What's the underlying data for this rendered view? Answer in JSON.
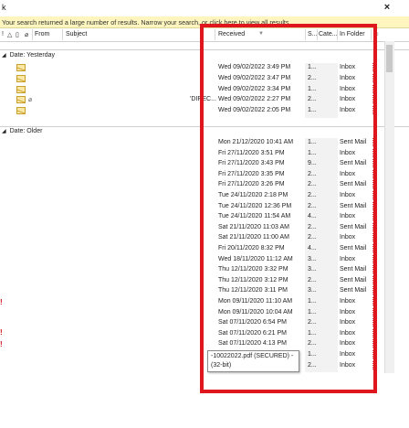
{
  "search": {
    "query": "k",
    "close_glyph": "×"
  },
  "infobar": {
    "message": "Your search returned a large number of results. Narrow your search, or click here to view all results."
  },
  "columns": {
    "from": "From",
    "subject": "Subject",
    "received": "Received",
    "size": "S...",
    "categories": "Cate...",
    "in_folder": "In Folder"
  },
  "groups": {
    "yesterday": "Date: Yesterday",
    "older": "Date: Older"
  },
  "yesterday_rows": [
    {
      "received": "Wed 09/02/2022 3:49 PM",
      "size": "1...",
      "folder": "Inbox"
    },
    {
      "received": "Wed 09/02/2022 3:47 PM",
      "size": "2...",
      "folder": "Inbox"
    },
    {
      "received": "Wed 09/02/2022 3:34 PM",
      "size": "1...",
      "folder": "Inbox"
    },
    {
      "received": "Wed 09/02/2022 2:27 PM",
      "size": "2...",
      "folder": "Inbox",
      "subject_fragment": "'DIREC..."
    },
    {
      "received": "Wed 09/02/2022 2:05 PM",
      "size": "1...",
      "folder": "Inbox"
    }
  ],
  "older_rows": [
    {
      "received": "Mon 21/12/2020 10:41 AM",
      "size": "1...",
      "folder": "Sent Mail"
    },
    {
      "received": "Fri 27/11/2020 3:51 PM",
      "size": "1...",
      "folder": "Inbox"
    },
    {
      "received": "Fri 27/11/2020 3:43 PM",
      "size": "9...",
      "folder": "Sent Mail"
    },
    {
      "received": "Fri 27/11/2020 3:35 PM",
      "size": "2...",
      "folder": "Inbox"
    },
    {
      "received": "Fri 27/11/2020 3:26 PM",
      "size": "2...",
      "folder": "Sent Mail"
    },
    {
      "received": "Tue 24/11/2020 2:18 PM",
      "size": "2...",
      "folder": "Inbox"
    },
    {
      "received": "Tue 24/11/2020 12:36 PM",
      "size": "2...",
      "folder": "Sent Mail"
    },
    {
      "received": "Tue 24/11/2020 11:54 AM",
      "size": "4...",
      "folder": "Inbox"
    },
    {
      "received": "Sat 21/11/2020 11:03 AM",
      "size": "2...",
      "folder": "Sent Mail"
    },
    {
      "received": "Sat 21/11/2020 11:00 AM",
      "size": "2...",
      "folder": "Inbox"
    },
    {
      "received": "Fri 20/11/2020 8:32 PM",
      "size": "4...",
      "folder": "Sent Mail"
    },
    {
      "received": "Wed 18/11/2020 11:12 AM",
      "size": "3...",
      "folder": "Inbox"
    },
    {
      "received": "Thu 12/11/2020 3:32 PM",
      "size": "3...",
      "folder": "Sent Mail"
    },
    {
      "received": "Thu 12/11/2020 3:12 PM",
      "size": "2...",
      "folder": "Sent Mail"
    },
    {
      "received": "Thu 12/11/2020 3:11 PM",
      "size": "3...",
      "folder": "Sent Mail"
    },
    {
      "received": "Mon 09/11/2020 11:10 AM",
      "size": "1...",
      "folder": "Inbox"
    },
    {
      "received": "Mon 09/11/2020 10:04 AM",
      "size": "1...",
      "folder": "Inbox"
    },
    {
      "received": "Sat 07/11/2020 6:54 PM",
      "size": "2...",
      "folder": "Inbox"
    },
    {
      "received": "Sat 07/11/2020 6:21 PM",
      "size": "1...",
      "folder": "Inbox"
    },
    {
      "received": "Sat 07/11/2020 4:13 PM",
      "size": "2...",
      "folder": "Inbox"
    },
    {
      "received": "",
      "size": "1...",
      "folder": "Inbox"
    },
    {
      "received": "",
      "size": "2...",
      "folder": "Inbox"
    }
  ],
  "tooltip": {
    "line1": "-10022022.pdf (SECURED) -",
    "line2": "(32-bit)"
  },
  "colors": {
    "highlight_box": "#e0161f",
    "infobar_bg": "#fff6bf",
    "flag_red": "#d0151b"
  }
}
